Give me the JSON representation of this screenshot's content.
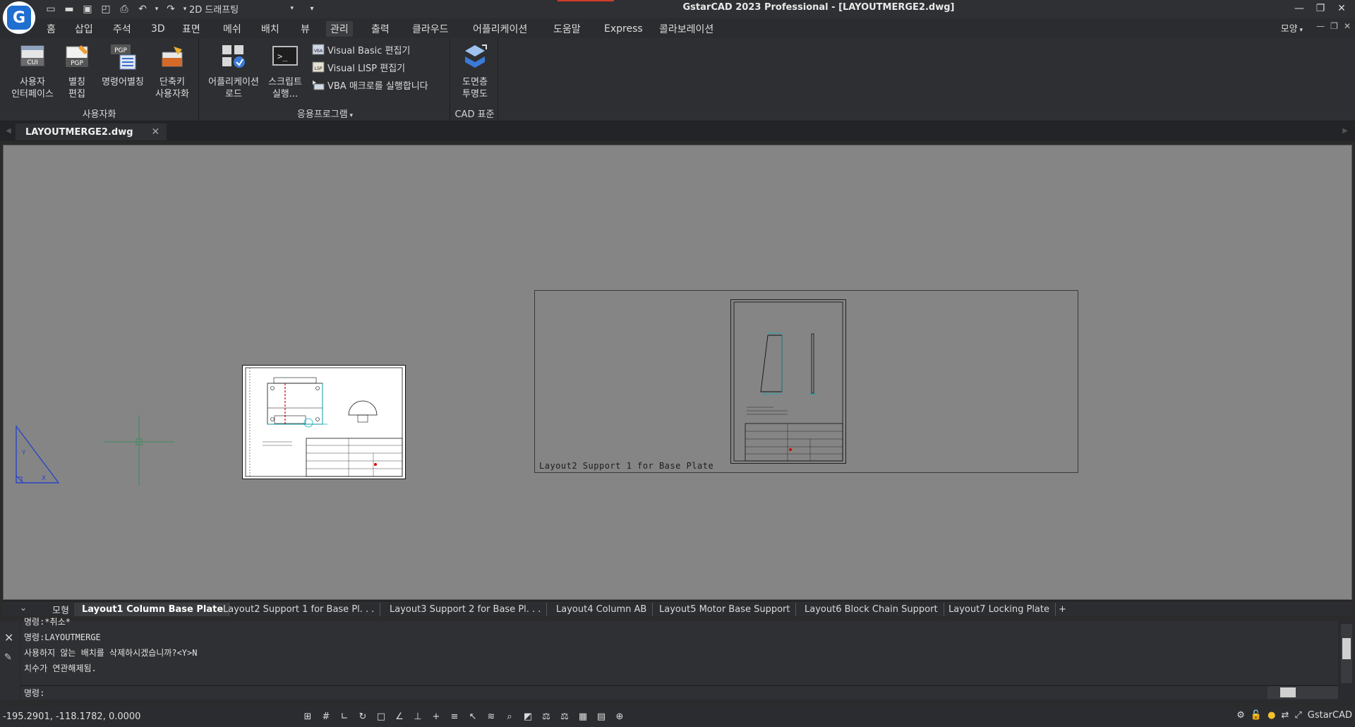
{
  "titlebar": {
    "workspace": "2D 드래프팅",
    "title": "GstarCAD 2023 Professional - [LAYOUTMERGE2.dwg]",
    "window_controls": [
      "minimize-icon",
      "restore-icon",
      "close-icon"
    ]
  },
  "menu": {
    "tabs": [
      "홈",
      "삽입",
      "주석",
      "3D",
      "표면",
      "메쉬",
      "배치",
      "뷰",
      "관리",
      "출력",
      "클라우드",
      "어플리케이션",
      "도움말",
      "Express",
      "콜라보레이션"
    ],
    "active": "관리",
    "mode_label": "모양"
  },
  "ribbon": {
    "customize": {
      "title": "사용자화",
      "buttons": [
        {
          "label": "사용자\n인터페이스",
          "icon": "cui-icon"
        },
        {
          "label": "별칭\n편집",
          "icon": "pgp-icon"
        },
        {
          "label": "명령어별칭",
          "icon": "pgp-list-icon"
        },
        {
          "label": "단축키\n사용자화",
          "icon": "shortcut-icon"
        }
      ]
    },
    "apps": {
      "title": "응용프로그램",
      "buttons": [
        {
          "label": "어플리케이션\n로드",
          "icon": "app-load-icon"
        },
        {
          "label": "스크립트\n실행...",
          "icon": "script-icon"
        }
      ],
      "small": [
        {
          "label": "Visual Basic 편집기",
          "icon": "vba-icon"
        },
        {
          "label": "Visual LISP 편집기",
          "icon": "vlisp-icon"
        },
        {
          "label": "VBA 매크로를 실행합니다",
          "icon": "vba-run-icon"
        }
      ]
    },
    "cad_std": {
      "title": "CAD 표준",
      "buttons": [
        {
          "label": "도면층\n투명도",
          "icon": "layer-transparency-icon"
        }
      ]
    }
  },
  "document": {
    "tab": "LAYOUTMERGE2.dwg"
  },
  "drawing": {
    "viewport_label": "Layout2  Support  1  for  Base  Plate"
  },
  "layouts": {
    "model": "모형",
    "tabs": [
      "Layout1 Column Base Plate",
      "Layout2 Support 1 for Base Pl. . .",
      "Layout3 Support 2 for Base Pl. . .",
      "Layout4 Column AB",
      "Layout5 Motor Base Support",
      "Layout6 Block Chain Support",
      "Layout7 Locking Plate"
    ],
    "add": "+"
  },
  "command": {
    "history": [
      "명령:*취소*",
      "명령:LAYOUTMERGE",
      "사용하지  않는  배치를  삭제하시겠습니까?<Y>N",
      "치수가  연관해제됨."
    ],
    "prompt": "명령:"
  },
  "status": {
    "coords": "-195.2901, -118.1782, 0.0000",
    "app_label": "GstarCAD"
  }
}
